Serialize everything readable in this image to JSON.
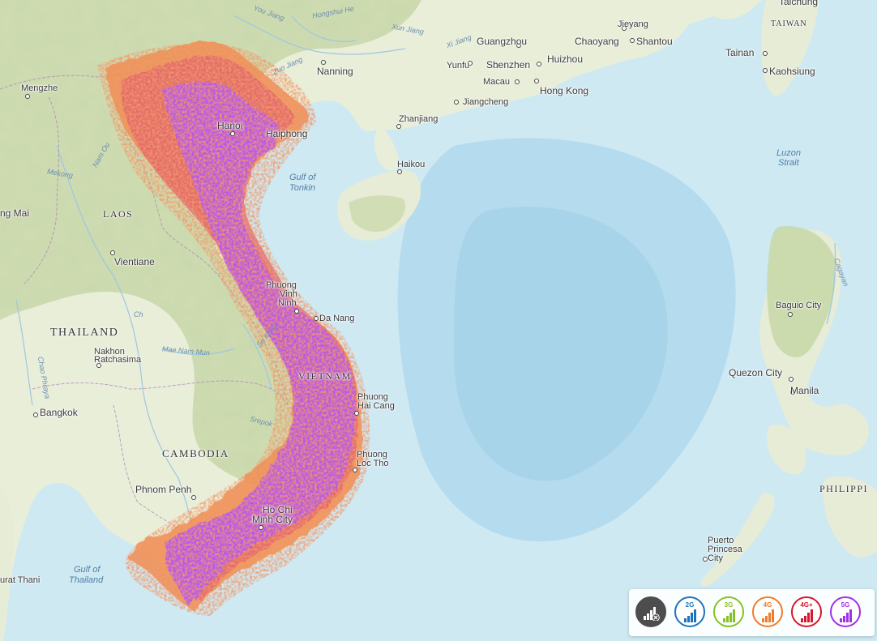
{
  "map": {
    "labels": {
      "cities": {
        "taichung": "Taichung",
        "jieyang": "Jieyang",
        "guangzhou": "Guangzhou",
        "chaoyang": "Chaoyang",
        "shantou": "Shantou",
        "nanning": "Nanning",
        "yunfu": "Yunfu",
        "shenzhen": "Shenzhen",
        "huizhou": "Huizhou",
        "tainan": "Tainan",
        "kaohsiung": "Kaohsiung",
        "mengzhe": "Mengzhe",
        "macau": "Macau",
        "hong_kong": "Hong Kong",
        "jiangcheng": "Jiangcheng",
        "hanoi": "Hanoi",
        "haiphong": "Haiphong",
        "zhanjiang": "Zhanjiang",
        "haikou": "Haikou",
        "ng_mai": "ng Mai",
        "vientiane": "Vientiane",
        "phuong_vinh_ninh_1": "Phuong",
        "phuong_vinh_ninh_2": "Vinh",
        "phuong_vinh_ninh_3": "Ninh",
        "da_nang": "Da Nang",
        "baguio": "Baguio City",
        "nakhon_1": "Nakhon",
        "nakhon_2": "Ratchasima",
        "quezon": "Quezon City",
        "manila": "Manila",
        "phuong_hai_cang_1": "Phuong",
        "phuong_hai_cang_2": "Hai Cang",
        "bangkok": "Bangkok",
        "phuong_loc_tho_1": "Phuong",
        "phuong_loc_tho_2": "Loc Tho",
        "phnom_penh": "Phnom Penh",
        "hcmc_1": "Ho Chi",
        "hcmc_2": "Minh City",
        "puerto_1": "Puerto",
        "puerto_2": "Princesa",
        "puerto_3": "City",
        "surat_thani": "urat Thani"
      },
      "countries": {
        "taiwan": "TAIWAN",
        "laos": "LAOS",
        "thailand": "THAILAND",
        "vietnam": "VIETNAM",
        "cambodia": "CAMBODIA",
        "philippines": "PHILIPPI"
      },
      "water": {
        "gulf_tonkin_1": "Gulf of",
        "gulf_tonkin_2": "Tonkin",
        "luzon_1": "Luzon",
        "luzon_2": "Strait",
        "gulf_thailand_1": "Gulf of",
        "gulf_thailand_2": "Thailand"
      },
      "rivers": {
        "you_jiang": "You Jiang",
        "hongshui": "Hongshui He",
        "xun_jiang": "Xun Jiang",
        "xi_jiang": "Xi Jiang",
        "zuo_jiang": "Zuo Jiang",
        "mekong": "Mekong",
        "nam_ou": "Nam Ou",
        "ch": "Ch",
        "mae_nam_mun": "Mae Nam Mun",
        "se_kong": "Se Kong",
        "srepok": "Srepok",
        "chao_phraya": "Chao Phraya",
        "cagayan": "Cagayan"
      }
    },
    "colors": {
      "sea": "#cfe9f3",
      "deep_sea": "#a9d6ea",
      "land": "#e9eed9",
      "forest": "#c3d3a0",
      "border": "#b58bbd",
      "coverage_5g": "#b557f0",
      "coverage_4g_plus": "#e1616f",
      "coverage_4g": "#f08a4c"
    }
  },
  "legend": {
    "items": [
      {
        "id": "none",
        "label": "",
        "icon": "no-signal-icon",
        "color": "#4d4d4d"
      },
      {
        "id": "2g",
        "label": "2G",
        "icon": "signal-bars-icon",
        "color": "#1e73be"
      },
      {
        "id": "3g",
        "label": "3G",
        "icon": "signal-bars-icon",
        "color": "#84c225"
      },
      {
        "id": "4g",
        "label": "4G",
        "icon": "signal-bars-icon",
        "color": "#f07b2b"
      },
      {
        "id": "4gplus",
        "label": "4G+",
        "icon": "signal-bars-icon",
        "color": "#d5172f"
      },
      {
        "id": "5g",
        "label": "5G",
        "icon": "signal-bars-icon",
        "color": "#a030e6"
      }
    ]
  }
}
